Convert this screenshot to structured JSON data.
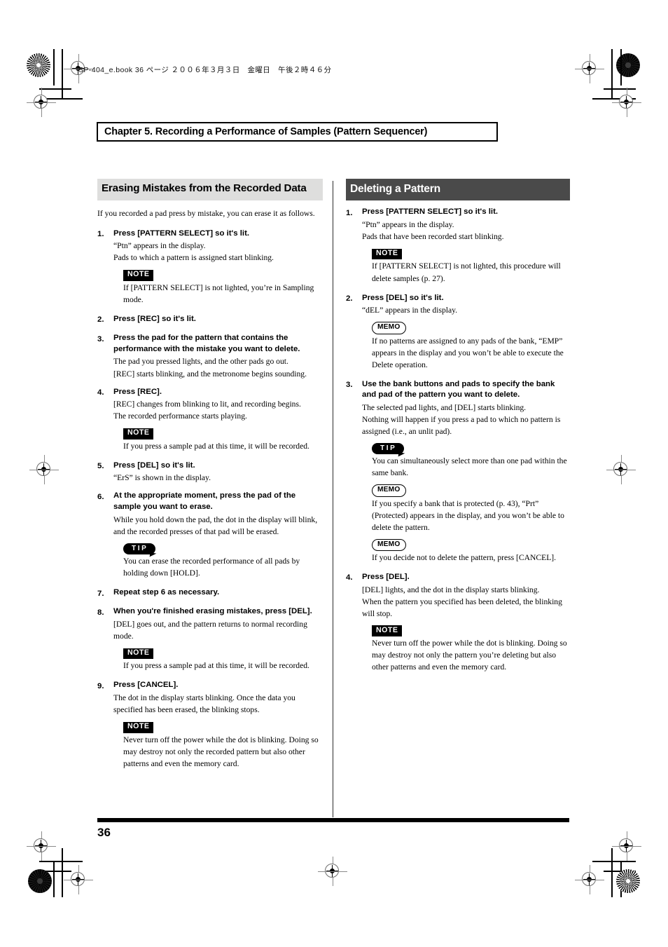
{
  "page": {
    "bookline": "SP-404_e.book  36 ページ  ２００６年３月３日　金曜日　午後２時４６分",
    "chapter_banner": "Chapter 5. Recording a Performance of Samples (Pattern Sequencer)",
    "page_number": "36",
    "colors": {
      "heading_gray_bg": "#dededd",
      "heading_dark_bg": "#4a4a4a",
      "badge_black": "#000000",
      "text": "#000000"
    }
  },
  "left_column": {
    "heading": "Erasing Mistakes from the Recorded Data",
    "intro": "If you recorded a pad press by mistake, you can erase it as follows.",
    "steps": [
      {
        "num": "1.",
        "title": "Press [PATTERN SELECT] so it's lit.",
        "lines": [
          "“Ptn” appears in the display.",
          "Pads to which a pattern is assigned start blinking."
        ],
        "callouts": [
          {
            "badge": "NOTE",
            "kind": "note",
            "text": "If [PATTERN SELECT] is not lighted, you’re in Sampling mode."
          }
        ]
      },
      {
        "num": "2.",
        "title": "Press [REC] so it's lit.",
        "lines": [],
        "callouts": []
      },
      {
        "num": "3.",
        "title": "Press the pad for the pattern that contains the performance with the mistake you want to delete.",
        "lines": [
          "The pad you pressed lights, and the other pads go out.",
          "[REC] starts blinking, and the metronome begins sounding."
        ],
        "callouts": []
      },
      {
        "num": "4.",
        "title": "Press [REC].",
        "lines": [
          "[REC] changes from blinking to lit, and recording begins.",
          "The recorded performance starts playing."
        ],
        "callouts": [
          {
            "badge": "NOTE",
            "kind": "note",
            "text": "If you press a sample pad at this time, it will be recorded."
          }
        ]
      },
      {
        "num": "5.",
        "title": "Press [DEL] so it's lit.",
        "lines": [
          "“ErS” is shown in the display."
        ],
        "callouts": []
      },
      {
        "num": "6.",
        "title": "At the appropriate moment, press the pad of the sample you want to erase.",
        "lines": [
          "While you hold down the pad, the dot in the display will blink, and the recorded presses of that pad will be erased."
        ],
        "callouts": [
          {
            "badge": "TIP",
            "kind": "tip",
            "text": "You can erase the recorded performance of all pads by holding down [HOLD]."
          }
        ]
      },
      {
        "num": "7.",
        "title": "Repeat step 6 as necessary.",
        "lines": [],
        "callouts": []
      },
      {
        "num": "8.",
        "title": "When you're finished erasing mistakes, press [DEL].",
        "lines": [
          "[DEL] goes out, and the pattern returns to normal recording mode."
        ],
        "callouts": [
          {
            "badge": "NOTE",
            "kind": "note",
            "text": "If you press a sample pad at this time, it will be recorded."
          }
        ]
      },
      {
        "num": "9.",
        "title": "Press [CANCEL].",
        "lines": [
          "The dot in the display starts blinking. Once the data you specified has been erased, the blinking stops."
        ],
        "callouts": [
          {
            "badge": "NOTE",
            "kind": "note",
            "text": "Never turn off the power while the dot is blinking. Doing so may destroy not only the recorded pattern but also other patterns and even the memory card."
          }
        ]
      }
    ]
  },
  "right_column": {
    "heading": "Deleting a Pattern",
    "steps": [
      {
        "num": "1.",
        "title": "Press [PATTERN SELECT] so it's lit.",
        "lines": [
          "“Ptn” appears in the display.",
          "Pads that have been recorded start blinking."
        ],
        "callouts": [
          {
            "badge": "NOTE",
            "kind": "note",
            "text": "If [PATTERN SELECT] is not lighted, this procedure will delete samples (p. 27)."
          }
        ]
      },
      {
        "num": "2.",
        "title": "Press [DEL] so it's lit.",
        "lines": [
          "“dEL” appears in the display."
        ],
        "callouts": [
          {
            "badge": "MEMO",
            "kind": "memo",
            "text": "If no patterns are assigned to any pads of the bank, “EMP” appears in the display and you won’t be able to execute the Delete operation."
          }
        ]
      },
      {
        "num": "3.",
        "title": "Use the bank buttons and pads to specify the bank and pad of the pattern you want to delete.",
        "lines": [
          "The selected pad lights, and [DEL] starts blinking.",
          "Nothing will happen if you press a pad to which no pattern is assigned (i.e., an unlit pad)."
        ],
        "callouts": [
          {
            "badge": "TIP",
            "kind": "tip",
            "text": "You can simultaneously select more than one pad within the same bank."
          },
          {
            "badge": "MEMO",
            "kind": "memo",
            "text": "If you specify a bank that is protected (p. 43), “Prt” (Protected) appears in the display, and you won’t be able to delete the pattern."
          },
          {
            "badge": "MEMO",
            "kind": "memo",
            "text": "If you decide not to delete the pattern, press [CANCEL]."
          }
        ]
      },
      {
        "num": "4.",
        "title": "Press [DEL].",
        "lines": [
          "[DEL] lights, and the dot in the display starts blinking.",
          "When the pattern you specified has been deleted, the blinking will stop."
        ],
        "callouts": [
          {
            "badge": "NOTE",
            "kind": "note",
            "text": "Never turn off the power while the dot is blinking. Doing so may destroy not only the pattern you’re deleting but also other patterns and even the memory card."
          }
        ]
      }
    ]
  }
}
